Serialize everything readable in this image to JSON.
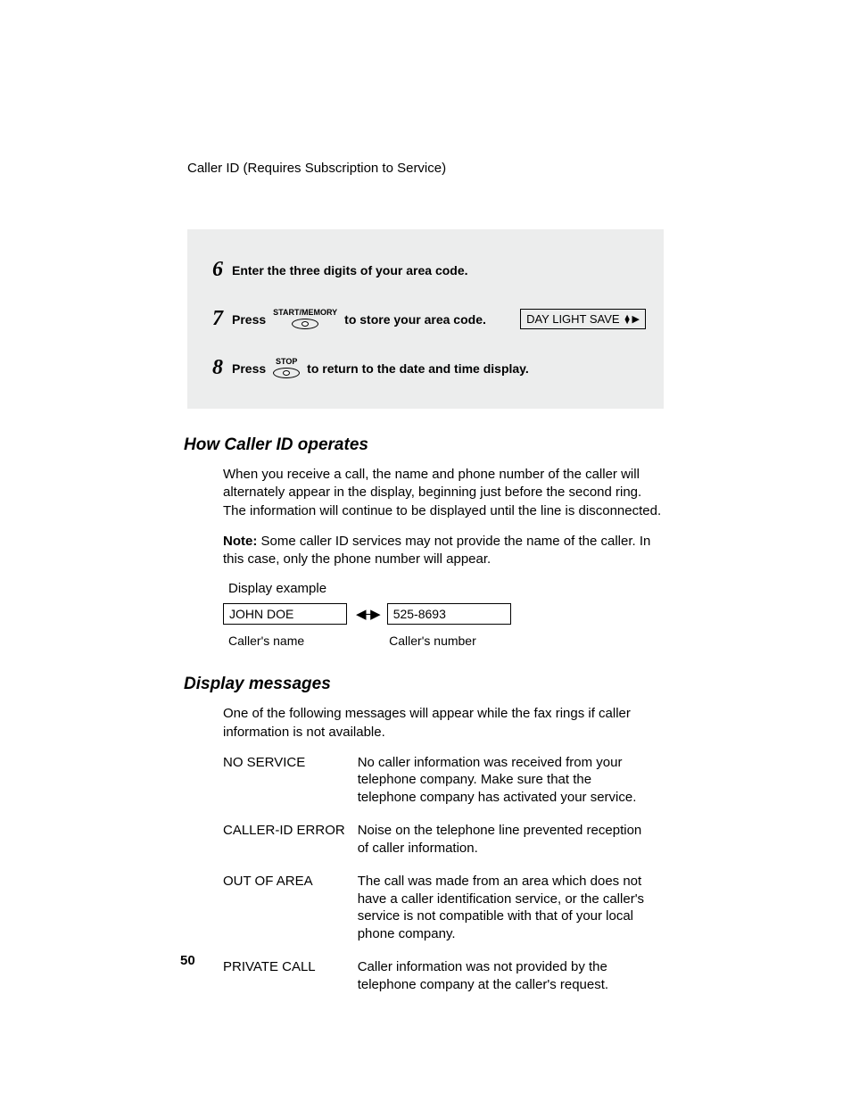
{
  "runningHead": "Caller ID (Requires Subscription to Service)",
  "steps": [
    {
      "num": "6",
      "pre": "Enter the three digits of your area code.",
      "key": null,
      "post": "",
      "lcd": null
    },
    {
      "num": "7",
      "pre": "Press",
      "key": "START/MEMORY",
      "post": "to store your area code.",
      "lcd": "DAY LIGHT SAVE"
    },
    {
      "num": "8",
      "pre": "Press",
      "key": "STOP",
      "post": "to return to the date and time display.",
      "lcd": null
    }
  ],
  "section1": {
    "title": "How Caller ID operates",
    "para1": "When you receive a call, the name and phone number of the caller will alternately appear in the display, beginning just before the second ring. The information will continue to be displayed until the line is disconnected.",
    "noteLabel": "Note:",
    "noteText": " Some caller ID services may not provide the name of the caller. In this case, only the phone number will appear.",
    "displayExampleLabel": "Display example",
    "exName": "JOHN DOE",
    "exNumber": "525-8693",
    "capName": "Caller's name",
    "capNumber": "Caller's number"
  },
  "section2": {
    "title": "Display messages",
    "intro": "One of the following messages will appear while the fax rings if caller information is not available.",
    "rows": [
      {
        "k": "NO SERVICE",
        "v": "No caller information was received from your telephone company. Make sure that the telephone company has activated your service."
      },
      {
        "k": "CALLER-ID ERROR",
        "v": "Noise on the telephone line prevented reception of caller information."
      },
      {
        "k": "OUT OF AREA",
        "v": "The call was made from an area which does not have a caller identification service, or the caller's service is not compatible with that of your local phone company."
      },
      {
        "k": "PRIVATE CALL",
        "v": "Caller information was not provided by the telephone company at the caller's request."
      }
    ]
  },
  "pageNumber": "50"
}
